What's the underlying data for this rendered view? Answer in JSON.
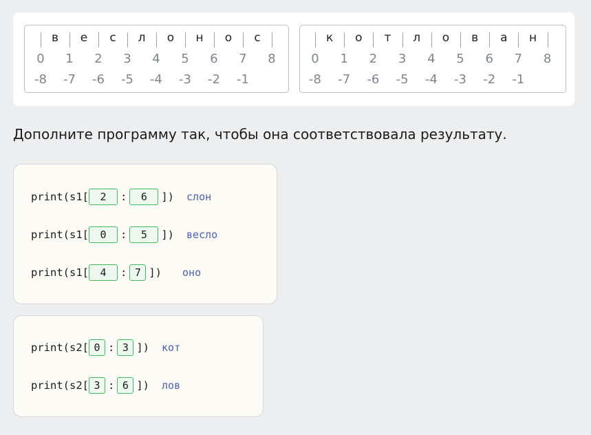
{
  "strings": [
    {
      "name": "s1",
      "chars": [
        "в",
        "е",
        "с",
        "л",
        "о",
        "н",
        "о",
        "с"
      ],
      "pos": [
        "0",
        "1",
        "2",
        "3",
        "4",
        "5",
        "6",
        "7",
        "8"
      ],
      "neg": [
        "-8",
        "-7",
        "-6",
        "-5",
        "-4",
        "-3",
        "-2",
        "-1"
      ]
    },
    {
      "name": "s2",
      "chars": [
        "к",
        "о",
        "т",
        "л",
        "о",
        "в",
        "а",
        "н"
      ],
      "pos": [
        "0",
        "1",
        "2",
        "3",
        "4",
        "5",
        "6",
        "7",
        "8"
      ],
      "neg": [
        "-8",
        "-7",
        "-6",
        "-5",
        "-4",
        "-3",
        "-2",
        "-1"
      ]
    }
  ],
  "task": {
    "text": "Дополните программу так, чтобы она соответствовала результату."
  },
  "code": {
    "s1_lines": [
      {
        "prefix": "print(s1[",
        "start": "2",
        "colon": ":",
        "end": "6",
        "suffix": "])",
        "result": "слон"
      },
      {
        "prefix": "print(s1[",
        "start": "0",
        "colon": ":",
        "end": "5",
        "suffix": "])",
        "result": "весло"
      },
      {
        "prefix": "print(s1[",
        "start": "4",
        "colon": ":",
        "end": "7",
        "suffix": "])",
        "result": "оно"
      }
    ],
    "s2_lines": [
      {
        "prefix": "print(s2[",
        "start": "0",
        "colon": ":",
        "end": "3",
        "suffix": "])",
        "result": "кот"
      },
      {
        "prefix": "print(s2[",
        "start": "3",
        "colon": ":",
        "end": "6",
        "suffix": "])",
        "result": "лов"
      }
    ]
  },
  "colors": {
    "slot_border": "#3dba5a",
    "result_text": "#4a5fc1",
    "index_text": "#7c8590"
  }
}
